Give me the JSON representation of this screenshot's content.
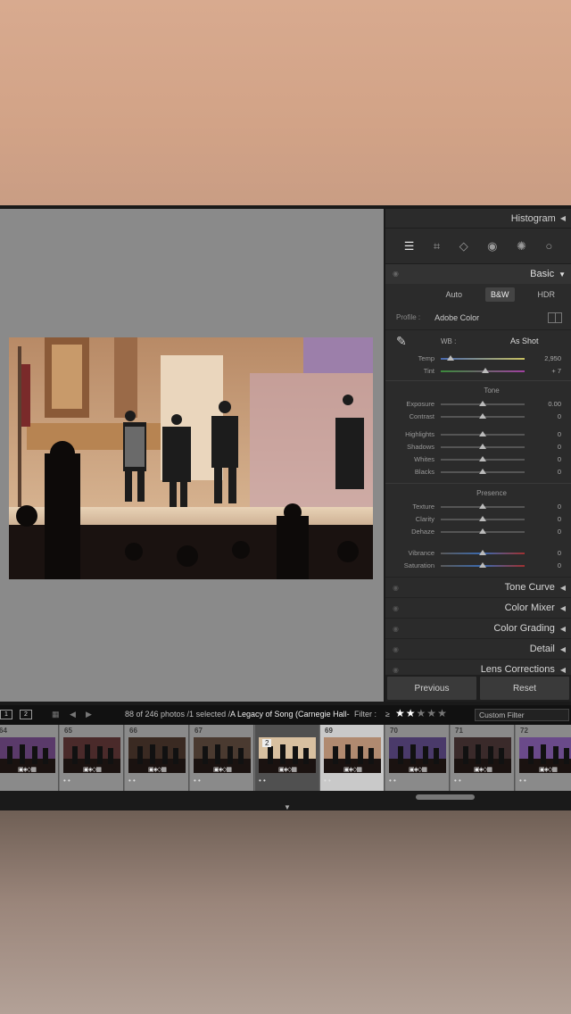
{
  "panel": {
    "histogram": "Histogram",
    "basic": "Basic",
    "modes": [
      "Auto",
      "B&W",
      "HDR"
    ],
    "profile_label": "Profile :",
    "profile_value": "Adobe Color",
    "wb_label": "WB :",
    "wb_value": "As Shot",
    "wb_sliders": [
      {
        "label": "Temp",
        "value": "2,950",
        "pos": 0.12
      },
      {
        "label": "Tint",
        "value": "+ 7",
        "pos": 0.53
      }
    ],
    "tone_title": "Tone",
    "tone_sliders": [
      {
        "label": "Exposure",
        "value": "0.00",
        "pos": 0.5
      },
      {
        "label": "Contrast",
        "value": "0",
        "pos": 0.5
      },
      {
        "label": "Highlights",
        "value": "0",
        "pos": 0.5
      },
      {
        "label": "Shadows",
        "value": "0",
        "pos": 0.5
      },
      {
        "label": "Whites",
        "value": "0",
        "pos": 0.5
      },
      {
        "label": "Blacks",
        "value": "0",
        "pos": 0.5
      }
    ],
    "presence_title": "Presence",
    "presence_sliders": [
      {
        "label": "Texture",
        "value": "0",
        "pos": 0.5
      },
      {
        "label": "Clarity",
        "value": "0",
        "pos": 0.5
      },
      {
        "label": "Dehaze",
        "value": "0",
        "pos": 0.5
      },
      {
        "label": "Vibrance",
        "value": "0",
        "pos": 0.5
      },
      {
        "label": "Saturation",
        "value": "0",
        "pos": 0.5
      }
    ],
    "sections": [
      "Tone Curve",
      "Color Mixer",
      "Color Grading",
      "Detail",
      "Lens Corrections"
    ],
    "previous": "Previous",
    "reset": "Reset"
  },
  "filmstrip": {
    "screen1": "1",
    "screen2": "2",
    "info_count": "88 of 246 photos /1 selected /",
    "info_folder": "A Legacy of Song (Carnegie Hall-",
    "filter_label": "Filter :",
    "filter_op": "≥",
    "rating": 2,
    "custom_filter": "Custom Filter",
    "cells": [
      {
        "num": "64",
        "style": "normal",
        "dots": "",
        "badge": ""
      },
      {
        "num": "65",
        "style": "normal",
        "dots": "• •",
        "badge": ""
      },
      {
        "num": "66",
        "style": "normal",
        "dots": "• •",
        "badge": ""
      },
      {
        "num": "67",
        "style": "normal",
        "dots": "• •",
        "badge": ""
      },
      {
        "num": "",
        "style": "dark",
        "dots": "• •",
        "badge": "2"
      },
      {
        "num": "69",
        "style": "sel",
        "dots": "• •",
        "badge": ""
      },
      {
        "num": "70",
        "style": "normal",
        "dots": "• •",
        "badge": ""
      },
      {
        "num": "71",
        "style": "normal",
        "dots": "• •",
        "badge": ""
      },
      {
        "num": "72",
        "style": "normal",
        "dots": "• •",
        "badge": ""
      }
    ]
  }
}
